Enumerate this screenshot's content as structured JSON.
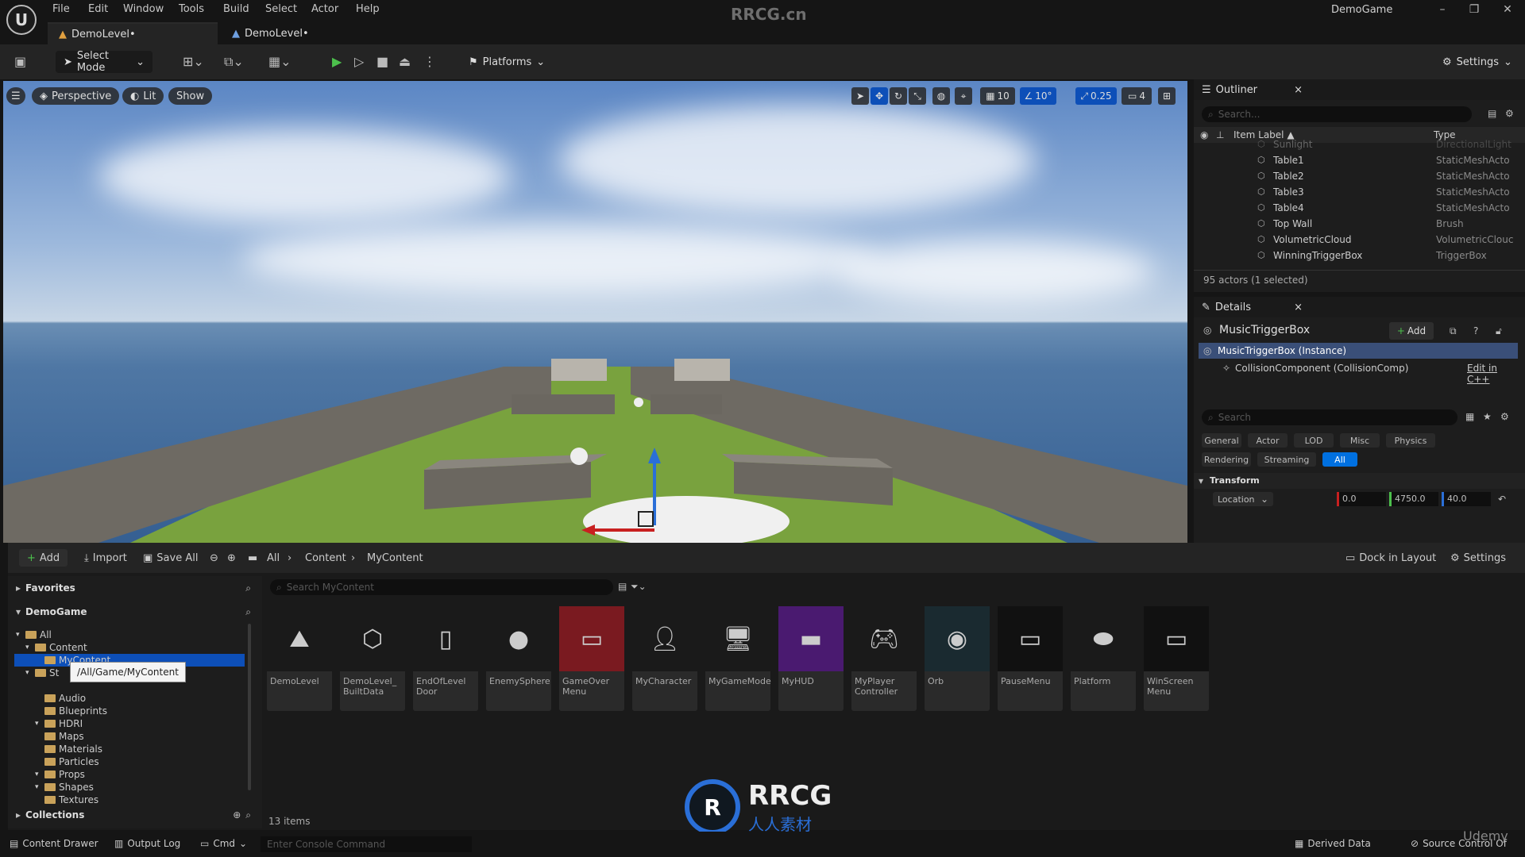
{
  "menu": [
    "File",
    "Edit",
    "Window",
    "Tools",
    "Build",
    "Select",
    "Actor",
    "Help"
  ],
  "watermark_title": "RRCG.cn",
  "project_name": "DemoGame",
  "tabs": [
    "DemoLevel•",
    "DemoLevel•"
  ],
  "toolbar": {
    "select_mode": "Select Mode",
    "platforms": "Platforms",
    "settings": "Settings"
  },
  "viewport": {
    "perspective": "Perspective",
    "lit": "Lit",
    "show": "Show",
    "grid_snap": "10",
    "rot_snap": "10°",
    "scale_snap": "0.25",
    "camera_speed": "4"
  },
  "outliner": {
    "title": "Outliner",
    "search_placeholder": "Search...",
    "col_label": "Item Label ▲",
    "col_type": "Type",
    "rows": [
      {
        "label": "Sunlight",
        "type": "DirectionalLight"
      },
      {
        "label": "Table1",
        "type": "StaticMeshActo"
      },
      {
        "label": "Table2",
        "type": "StaticMeshActo"
      },
      {
        "label": "Table3",
        "type": "StaticMeshActo"
      },
      {
        "label": "Table4",
        "type": "StaticMeshActo"
      },
      {
        "label": "Top Wall",
        "type": "Brush"
      },
      {
        "label": "VolumetricCloud",
        "type": "VolumetricClouc"
      },
      {
        "label": "WinningTriggerBox",
        "type": "TriggerBox"
      }
    ],
    "status": "95 actors (1 selected)"
  },
  "details": {
    "title": "Details",
    "actor_name": "MusicTriggerBox",
    "add_label": "Add",
    "instance": "MusicTriggerBox (Instance)",
    "component": "CollisionComponent (CollisionComp)",
    "edit_cpp": "Edit in C++",
    "search_placeholder": "Search",
    "categories_row1": [
      "General",
      "Actor",
      "LOD",
      "Misc",
      "Physics"
    ],
    "categories_row2": [
      "Rendering",
      "Streaming",
      "All"
    ],
    "section": "Transform",
    "location_label": "Location",
    "location": [
      "0.0",
      "4750.0",
      "40.0"
    ]
  },
  "browser": {
    "add": "Add",
    "import": "Import",
    "save_all": "Save All",
    "breadcrumb": [
      "All",
      "Content",
      "MyContent"
    ],
    "dock": "Dock in Layout",
    "settings": "Settings",
    "favorites": "Favorites",
    "project": "DemoGame",
    "collections": "Collections",
    "search_placeholder": "Search MyContent",
    "tooltip": "/All/Game/MyContent",
    "tree": [
      "All",
      "Content",
      "MyContent",
      "St",
      "Audio",
      "Blueprints",
      "HDRI",
      "Maps",
      "Materials",
      "Particles",
      "Props",
      "Shapes",
      "Textures"
    ],
    "assets": [
      {
        "name": "DemoLevel",
        "icon": "level-icon"
      },
      {
        "name": "DemoLevel_ BuiltData",
        "icon": "cube-icon"
      },
      {
        "name": "EndOfLevel Door",
        "icon": "door-icon"
      },
      {
        "name": "EnemySphere",
        "icon": "sphere-icon"
      },
      {
        "name": "GameOver Menu",
        "icon": "widget-icon"
      },
      {
        "name": "MyCharacter",
        "icon": "character-icon"
      },
      {
        "name": "MyGameMode",
        "icon": "gamemode-icon"
      },
      {
        "name": "MyHUD",
        "icon": "hud-icon"
      },
      {
        "name": "MyPlayer Controller",
        "icon": "gamepad-icon"
      },
      {
        "name": "Orb",
        "icon": "orb-icon"
      },
      {
        "name": "PauseMenu",
        "icon": "widget-icon"
      },
      {
        "name": "Platform",
        "icon": "platform-icon"
      },
      {
        "name": "WinScreen Menu",
        "icon": "widget-icon"
      }
    ],
    "item_count": "13 items",
    "logo_text": "RRCG",
    "logo_sub": "人人素材"
  },
  "status": {
    "drawer": "Content Drawer",
    "output": "Output Log",
    "cmd": "Cmd",
    "console_placeholder": "Enter Console Command",
    "derived": "Derived Data",
    "source": "Source Control Of",
    "udemy": "Udemy"
  },
  "colors": {
    "accent": "#0070e0",
    "selection": "#0d4fb8",
    "gizmo_blue": "#2a6fd8",
    "gizmo_red": "#c82020"
  }
}
